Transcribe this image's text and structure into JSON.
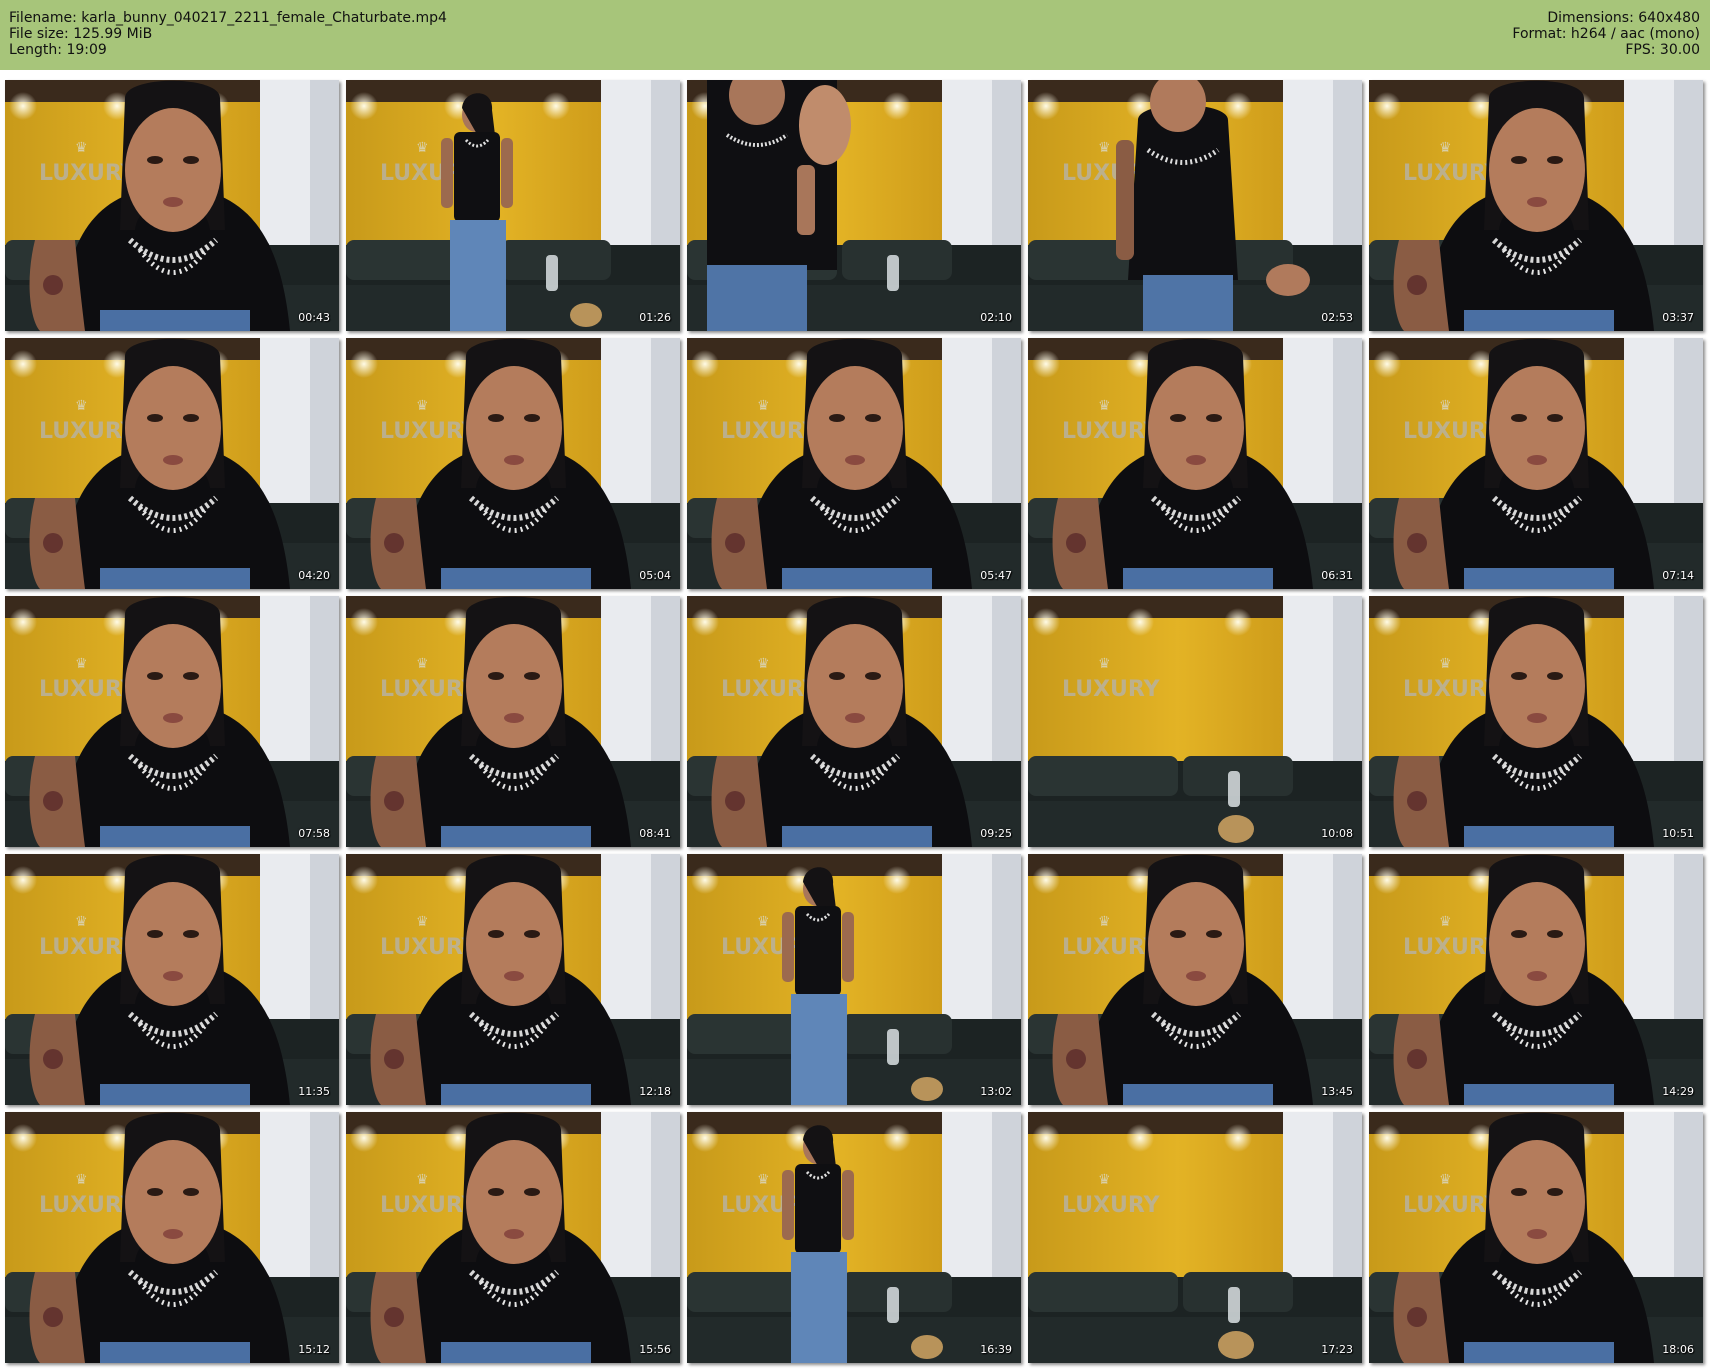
{
  "header": {
    "filename": "Filename: karla_bunny_040217_2211_female_Chaturbate.mp4",
    "filesize": "File size: 125.99 MiB",
    "length": "Length: 19:09",
    "dimensions": "Dimensions: 640x480",
    "format": "Format: h264 / aac (mono)",
    "fps": "FPS: 30.00"
  },
  "thumbnails": [
    {
      "time": "00:43",
      "variant": "close"
    },
    {
      "time": "01:26",
      "variant": "far"
    },
    {
      "time": "02:10",
      "variant": "wave"
    },
    {
      "time": "02:53",
      "variant": "mid"
    },
    {
      "time": "03:37",
      "variant": "close"
    },
    {
      "time": "04:20",
      "variant": "close"
    },
    {
      "time": "05:04",
      "variant": "close"
    },
    {
      "time": "05:47",
      "variant": "close"
    },
    {
      "time": "06:31",
      "variant": "close"
    },
    {
      "time": "07:14",
      "variant": "close"
    },
    {
      "time": "07:58",
      "variant": "close"
    },
    {
      "time": "08:41",
      "variant": "close"
    },
    {
      "time": "09:25",
      "variant": "close"
    },
    {
      "time": "10:08",
      "variant": "empty"
    },
    {
      "time": "10:51",
      "variant": "close"
    },
    {
      "time": "11:35",
      "variant": "close"
    },
    {
      "time": "12:18",
      "variant": "close"
    },
    {
      "time": "13:02",
      "variant": "far"
    },
    {
      "time": "13:45",
      "variant": "close"
    },
    {
      "time": "14:29",
      "variant": "close"
    },
    {
      "time": "15:12",
      "variant": "close"
    },
    {
      "time": "15:56",
      "variant": "close"
    },
    {
      "time": "16:39",
      "variant": "far"
    },
    {
      "time": "17:23",
      "variant": "empty"
    },
    {
      "time": "18:06",
      "variant": "close"
    }
  ]
}
